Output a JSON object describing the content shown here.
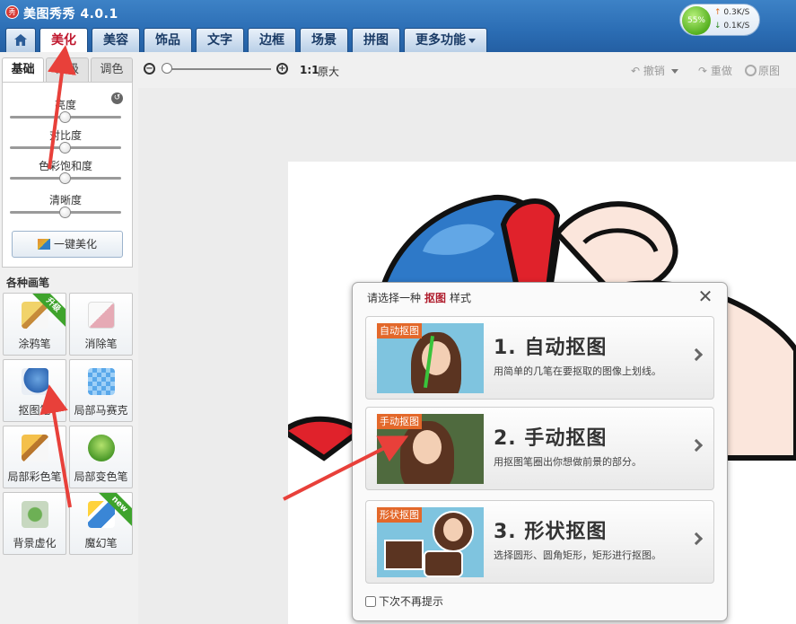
{
  "app": {
    "title": "美图秀秀 4.0.1",
    "logo_char": "秀"
  },
  "nav": {
    "tabs": [
      {
        "label": "美化",
        "active": true
      },
      {
        "label": "美容"
      },
      {
        "label": "饰品"
      },
      {
        "label": "文字"
      },
      {
        "label": "边框"
      },
      {
        "label": "场景"
      },
      {
        "label": "拼图"
      }
    ],
    "more_label": "更多功能"
  },
  "network": {
    "percent": "55%",
    "up": "0.3K/S",
    "down": "0.1K/S"
  },
  "subtabs": [
    "基础",
    "高级",
    "调色"
  ],
  "adjust": {
    "sliders": [
      {
        "label": "亮度",
        "level": 0.5
      },
      {
        "label": "对比度",
        "level": 0.5
      },
      {
        "label": "色彩饱和度",
        "level": 0.5
      },
      {
        "label": "清晰度",
        "level": 0.5
      }
    ],
    "onekey_label": "一键美化"
  },
  "brushes": {
    "section_title": "各种画笔",
    "items": [
      {
        "label": "涂鸦笔",
        "badge": "升级"
      },
      {
        "label": "消除笔"
      },
      {
        "label": "抠图笔"
      },
      {
        "label": "局部马赛克"
      },
      {
        "label": "局部彩色笔"
      },
      {
        "label": "局部变色笔"
      },
      {
        "label": "背景虚化"
      },
      {
        "label": "魔幻笔",
        "badge": "new"
      }
    ]
  },
  "toolbar": {
    "zoom_ratio": "1:1",
    "original_size": "原大",
    "undo": "撤销",
    "redo": "重做",
    "original": "原图"
  },
  "dialog": {
    "title_prefix": "请选择一种",
    "title_highlight": "抠图",
    "title_suffix": "样式",
    "options": [
      {
        "tag": "自动抠图",
        "title": "1. 自动抠图",
        "desc": "用简单的几笔在要抠取的图像上划线。"
      },
      {
        "tag": "手动抠图",
        "title": "2. 手动抠图",
        "desc": "用抠图笔圈出你想做前景的部分。"
      },
      {
        "tag": "形状抠图",
        "title": "3. 形状抠图",
        "desc": "选择圆形、圆角矩形，矩形进行抠图。"
      }
    ],
    "dont_show_label": "下次不再提示"
  },
  "colors": {
    "accent_red": "#b01e2e",
    "nav_blue": "#2b6db4",
    "annotation_red": "#e8403a"
  }
}
